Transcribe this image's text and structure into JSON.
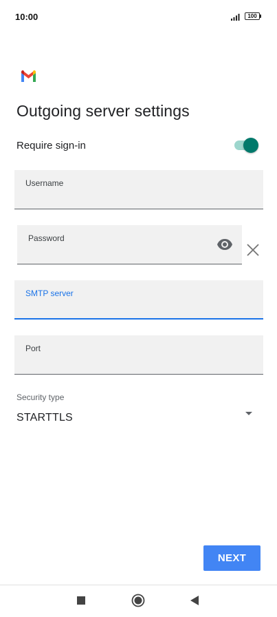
{
  "status_bar": {
    "time": "10:00",
    "battery": "100"
  },
  "app": {
    "logo_icon": "gmail-icon",
    "colors": {
      "accent": "#00796b",
      "primary": "#4285f4",
      "focus": "#1a73e8"
    }
  },
  "page": {
    "title": "Outgoing server settings"
  },
  "require_signin": {
    "label": "Require sign-in",
    "enabled": true
  },
  "fields": {
    "username": {
      "label": "Username",
      "value": ""
    },
    "password": {
      "label": "Password",
      "value": ""
    },
    "smtp_server": {
      "label": "SMTP server",
      "value": ""
    },
    "port": {
      "label": "Port",
      "value": ""
    }
  },
  "icons": {
    "password_visibility": "eye-icon",
    "clear": "close-icon"
  },
  "security": {
    "label": "Security type",
    "selected": "STARTTLS"
  },
  "actions": {
    "next_label": "NEXT"
  },
  "nav_bar": {
    "icons": [
      "recents-icon",
      "home-icon",
      "back-icon"
    ]
  }
}
